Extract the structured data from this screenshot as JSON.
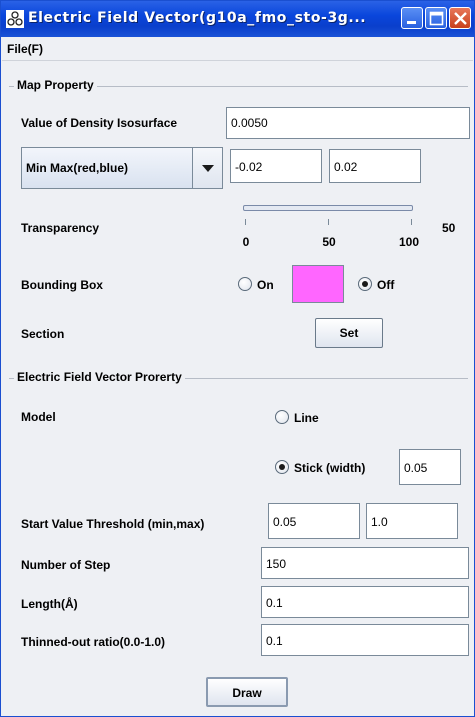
{
  "window": {
    "title": "Electric Field Vector(g10a_fmo_sto-3g...",
    "buttons": {
      "minimize": "minimize-icon",
      "maximize": "maximize-icon",
      "close": "close-icon"
    },
    "accent": "#0a46dc"
  },
  "menu": {
    "file": "File(F)"
  },
  "map_property": {
    "group_title": "Map Property",
    "density_label": "Value of Density Isosurface",
    "density_value": "0.0050",
    "range_mode": "Min Max(red,blue)",
    "range_min": "-0.02",
    "range_max": "0.02",
    "transparency_label": "Transparency",
    "transparency_value": "50",
    "transparency_level": 0.5,
    "transparency_ticks": [
      "0",
      "50",
      "100"
    ],
    "bounding_box_label": "Bounding Box",
    "bounding_on": "On",
    "bounding_off": "Off",
    "bounding_selected": "Off",
    "bounding_color": "#ff66ff",
    "section_label": "Section",
    "section_button": "Set"
  },
  "efv_property": {
    "group_title": "Electric Field Vector Prorerty",
    "model_label": "Model",
    "model_line": "Line",
    "model_stick": "Stick (width)",
    "model_selected": "Stick (width)",
    "stick_width": "0.05",
    "threshold_label": "Start Value Threshold (min,max)",
    "threshold_min": "0.05",
    "threshold_max": "1.0",
    "steps_label": "Number of Step",
    "steps_value": "150",
    "length_label": "Length(Å)",
    "length_value": "0.1",
    "thinned_label": "Thinned-out ratio(0.0-1.0)",
    "thinned_value": "0.1"
  },
  "actions": {
    "draw": "Draw"
  }
}
